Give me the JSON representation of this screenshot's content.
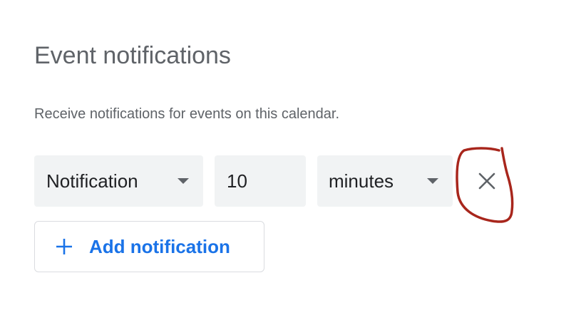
{
  "section": {
    "title": "Event notifications",
    "description": "Receive notifications for events on this calendar."
  },
  "notification_row": {
    "type_value": "Notification",
    "amount_value": "10",
    "unit_value": "minutes"
  },
  "add_button": {
    "label": "Add notification"
  },
  "icons": {
    "dropdown": "caret-down-icon",
    "remove": "close-icon",
    "add": "plus-icon"
  },
  "colors": {
    "text_secondary": "#5f6368",
    "text_primary": "#202124",
    "field_background": "#f1f3f4",
    "accent": "#1a73e8",
    "annotation": "#a8261c"
  }
}
